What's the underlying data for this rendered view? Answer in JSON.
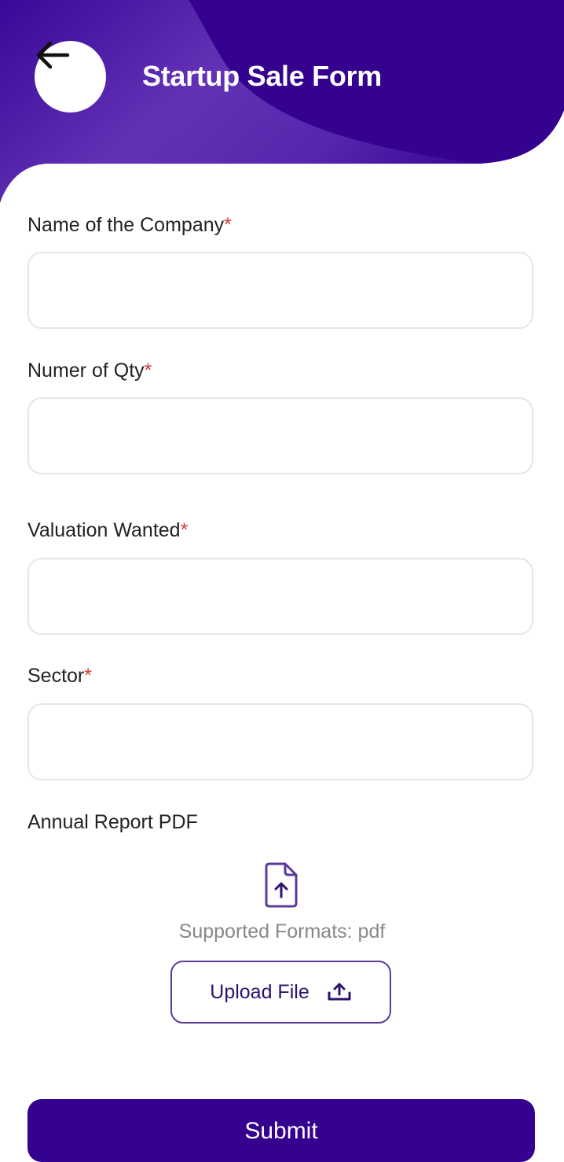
{
  "header": {
    "title": "Startup Sale Form",
    "back_icon": "arrow-left-icon",
    "colors": {
      "primary": "#35028f",
      "highlight": "#5a2db0"
    }
  },
  "form": {
    "fields": [
      {
        "label": "Name of the Company",
        "required_mark": "*",
        "value": ""
      },
      {
        "label": "Numer of Qty",
        "required_mark": "*",
        "value": ""
      },
      {
        "label": "Valuation Wanted",
        "required_mark": "*",
        "value": ""
      },
      {
        "label": "Sector",
        "required_mark": "*",
        "value": ""
      }
    ],
    "annual_report": {
      "label": "Annual Report PDF",
      "file_icon": "file-upload-icon",
      "supported_formats": "Supported Formats: pdf",
      "upload_label": "Upload File",
      "upload_icon": "upload-icon"
    },
    "submit_label": "Submit"
  }
}
